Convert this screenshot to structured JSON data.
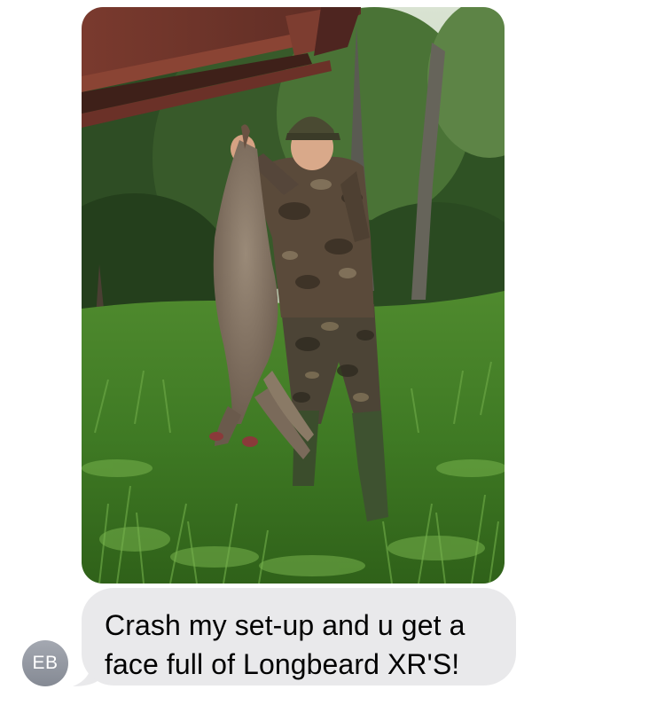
{
  "message": {
    "attachment": {
      "type": "photo",
      "subject": "hunter-with-coyote-photo"
    },
    "text_lines": [
      "Crash my set-up and u get a",
      "face full of Longbeard XR'S!"
    ],
    "bubble_color": "#e9e9eb",
    "text_color": "#000000"
  },
  "sender": {
    "initials": "EB",
    "avatar_color": "#8e939c"
  }
}
